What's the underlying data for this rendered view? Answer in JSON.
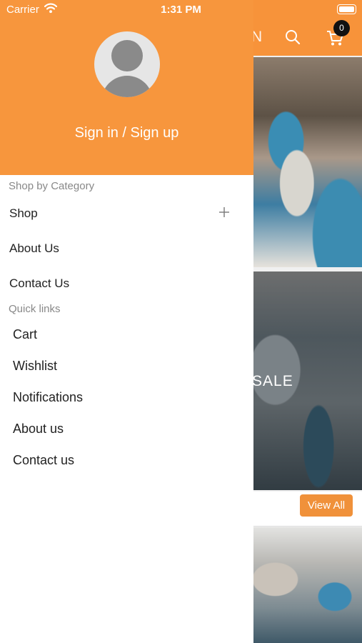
{
  "status_bar": {
    "carrier": "Carrier",
    "time": "1:31 PM"
  },
  "background_app": {
    "header_letter": "N",
    "cart_count": "0",
    "banner_text": "SALE",
    "view_all_label": "View All"
  },
  "drawer": {
    "sign_in_label": "Sign in / Sign up",
    "shop_by_category_label": "Shop by Category",
    "category_items": [
      {
        "label": "Shop"
      },
      {
        "label": "About Us"
      },
      {
        "label": "Contact Us"
      }
    ],
    "quick_links_label": "Quick links",
    "quick_links": [
      {
        "label": "Cart"
      },
      {
        "label": "Wishlist"
      },
      {
        "label": "Notifications"
      },
      {
        "label": "About us"
      },
      {
        "label": "Contact us"
      }
    ]
  },
  "colors": {
    "accent": "#f7963d",
    "button": "#f0913a"
  },
  "icons": [
    "wifi-icon",
    "battery-icon",
    "search-icon",
    "cart-icon",
    "avatar-icon",
    "plus-icon"
  ]
}
